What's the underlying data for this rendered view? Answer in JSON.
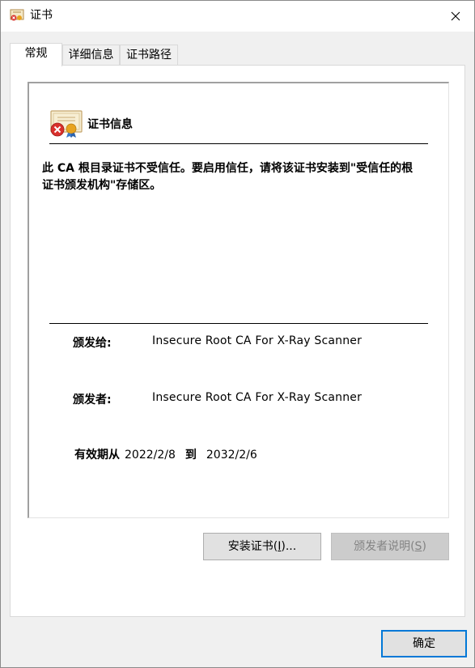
{
  "window": {
    "title": "证书",
    "close_icon": "close-icon"
  },
  "tabs": [
    {
      "label": "常规",
      "active": true
    },
    {
      "label": "详细信息",
      "active": false
    },
    {
      "label": "证书路径",
      "active": false
    }
  ],
  "general": {
    "heading": "证书信息",
    "warning": "此 CA 根目录证书不受信任。要启用信任，请将该证书安装到\"受信任的根证书颁发机构\"存储区。",
    "issued_to_label": "颁发给:",
    "issued_to_value": "Insecure Root CA For X-Ray Scanner",
    "issued_by_label": "颁发者:",
    "issued_by_value": "Insecure Root CA For X-Ray Scanner",
    "valid_from_label": "有效期从",
    "valid_from": "2022/2/8",
    "valid_to_label": "到",
    "valid_to": "2032/2/6"
  },
  "buttons": {
    "install_prefix": "安装证书(",
    "install_key": "I",
    "install_suffix": ")...",
    "issuer_prefix": "颁发者说明(",
    "issuer_key": "S",
    "issuer_suffix": ")",
    "ok": "确定"
  },
  "colors": {
    "accent": "#0078d7",
    "window_bg": "#f0f0f0",
    "panel_bg": "#ffffff",
    "disabled_text": "#838383"
  }
}
